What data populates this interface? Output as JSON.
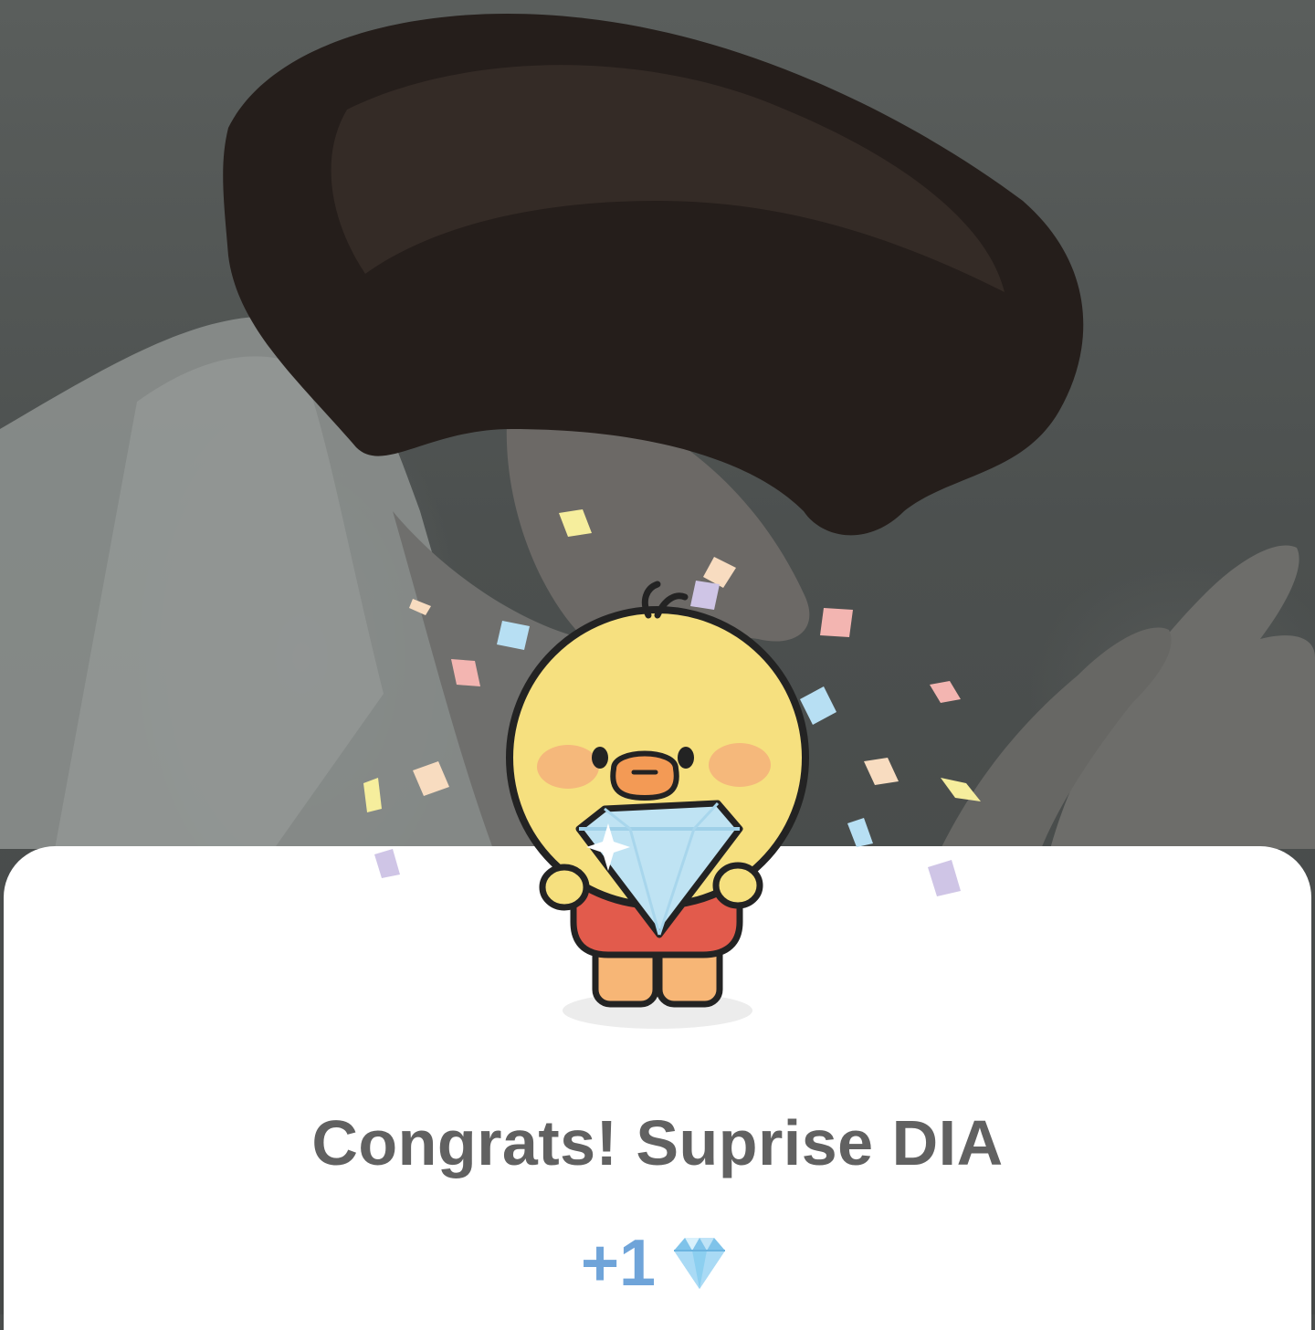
{
  "background": {
    "subject": "photo-person",
    "overlay_color": "#4a4d4c"
  },
  "dialog": {
    "illustration": "duck-holding-diamond",
    "title": "Congrats! Suprise DIA",
    "reward_amount": "+1",
    "reward_icon": "diamond-icon"
  },
  "colors": {
    "sheet_bg": "#ffffff",
    "title_text": "#616161",
    "reward_text": "#6fa4d9",
    "gem_light": "#bfe3f7",
    "gem_dark": "#7fc3ea"
  }
}
